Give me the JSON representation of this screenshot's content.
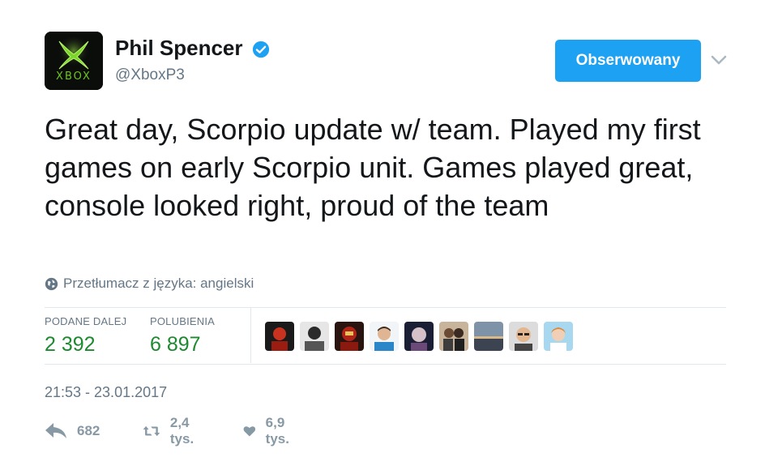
{
  "profile": {
    "avatar_text": "XBOX",
    "display_name": "Phil Spencer",
    "verified": true,
    "handle": "@XboxP3"
  },
  "follow": {
    "label": "Obserwowany"
  },
  "tweet": {
    "text": "Great day, Scorpio update w/ team. Played my first games on early Scorpio unit. Games played great, console looked right, proud of the team",
    "translate_label": "Przetłumacz z języka: angielski"
  },
  "stats": {
    "retweets_label": "PODANE DALEJ",
    "retweets_value": "2 392",
    "likes_label": "POLUBIENIA",
    "likes_value": "6 897"
  },
  "likers_count": 9,
  "timestamp": "21:53 - 23.01.2017",
  "actions": {
    "reply_count": "682",
    "retweet_count": "2,4 tys.",
    "like_count": "6,9 tys."
  },
  "colors": {
    "accent": "#1da1f2",
    "stat_value": "#1d8a30",
    "muted": "#657786",
    "action_icon": "#8899a6",
    "brand_green": "#6ec41e"
  }
}
